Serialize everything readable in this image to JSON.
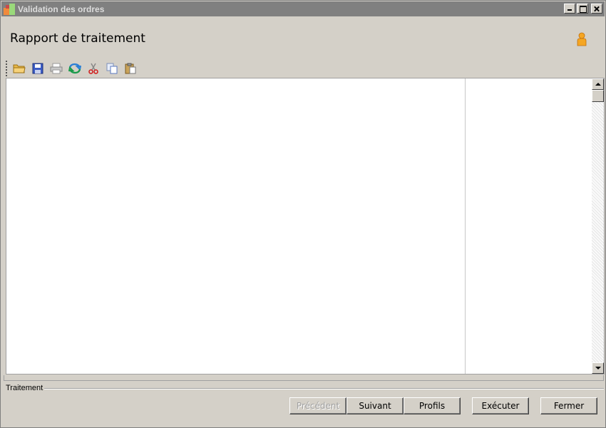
{
  "window": {
    "title": "Validation des ordres"
  },
  "header": {
    "title": "Rapport de traitement",
    "user_icon": "user-icon"
  },
  "toolbar": {
    "icons": [
      "folder-open-icon",
      "save-icon",
      "print-icon",
      "refresh-icon",
      "cut-icon",
      "copy-icon",
      "paste-icon"
    ]
  },
  "group": {
    "label": "Traitement"
  },
  "buttons": {
    "previous": "Précédent",
    "next": "Suivant",
    "profiles": "Profils",
    "execute": "Exécuter",
    "close": "Fermer"
  },
  "colors": {
    "titlebar": "#808080",
    "window_bg": "#d4d0c8",
    "content_bg": "#ffffff"
  }
}
